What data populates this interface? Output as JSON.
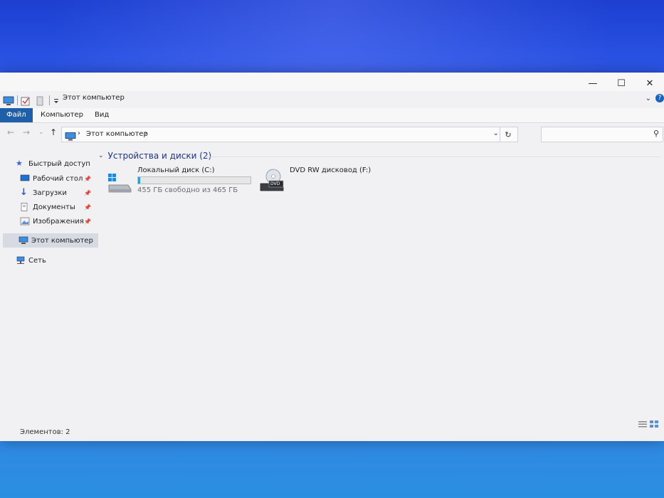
{
  "window": {
    "title": "Этот компьютер",
    "controls": {
      "minimize": "—",
      "maximize": "☐",
      "close": "✕"
    },
    "help": "?"
  },
  "ribbon": {
    "tabs": [
      {
        "label": "Файл"
      },
      {
        "label": "Компьютер"
      },
      {
        "label": "Вид"
      }
    ]
  },
  "address": {
    "path": "Этот компьютер",
    "separator": "›",
    "search_placeholder": ""
  },
  "nav_pane": {
    "quick_access": "Быстрый доступ",
    "items": [
      {
        "label": "Рабочий стол"
      },
      {
        "label": "Загрузки"
      },
      {
        "label": "Документы"
      },
      {
        "label": "Изображения"
      }
    ],
    "this_pc": "Этот компьютер",
    "network": "Сеть"
  },
  "content": {
    "group_title": "Устройства и диски (2)",
    "drives": [
      {
        "name": "Локальный диск (C:)",
        "free_text": "455 ГБ свободно из 465 ГБ",
        "used_fraction": 0.021
      },
      {
        "name": "DVD RW дисковод (F:)",
        "icon_label": "DVD"
      }
    ]
  },
  "status": {
    "items_count": "Элементов: 2"
  },
  "colors": {
    "file_tab": "#1f5fa9",
    "accent_text": "#1e3287",
    "drive_bar_fill": "#26a0da",
    "selected_nav": "#d6dae3"
  }
}
